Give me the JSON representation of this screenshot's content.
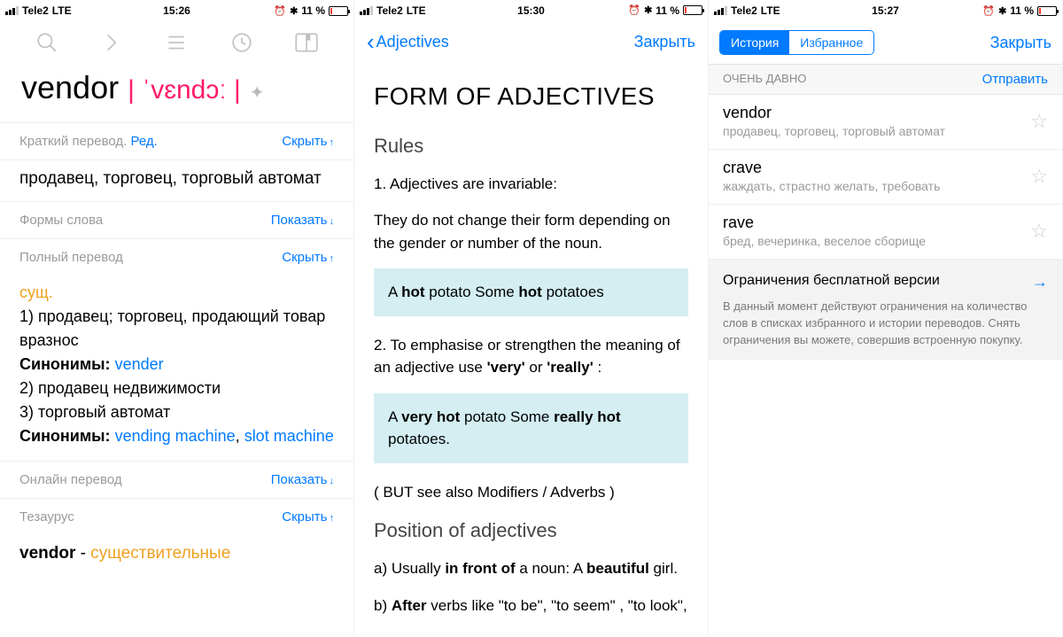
{
  "status": {
    "carrier": "Tele2",
    "network": "LTE",
    "battery_pct": "11 %",
    "alarm_icon": "⏰",
    "bt_icon": "✱"
  },
  "screen1": {
    "time": "15:26",
    "headword": "vendor",
    "phonetic": "| ˈvɛndɔː |",
    "brief_label": "Краткий перевод.",
    "edit": "Ред.",
    "hide": "Скрыть",
    "show": "Показать",
    "brief_translation": "продавец, торговец, торговый автомат",
    "forms_label": "Формы слова",
    "full_label": "Полный перевод",
    "pos": "сущ.",
    "line1": "1) продавец; торговец, продающий товар вразнос",
    "syn_label": "Синонимы:",
    "syn1": "vender",
    "line2": "2) продавец недвижимости",
    "line3": "3) торговый автомат",
    "syn2a": "vending machine",
    "syn2b": "slot machine",
    "online_label": "Онлайн перевод",
    "thesaurus_label": "Тезаурус",
    "thesaurus_word": "vendor",
    "thesaurus_pos": "существительные"
  },
  "screen2": {
    "time": "15:30",
    "back": "Adjectives",
    "close": "Закрыть",
    "title": "FORM OF ADJECTIVES",
    "rules": "Rules",
    "p1": "1. Adjectives are invariable:",
    "p2": "They do not change their form depending on the gender or number of the noun.",
    "ex1_a": "A ",
    "ex1_b": "hot",
    "ex1_c": " potato Some ",
    "ex1_d": "hot",
    "ex1_e": " potatoes",
    "p3a": "2. To emphasise or strengthen the meaning of an adjective use ",
    "p3b": "'very'",
    "p3c": " or ",
    "p3d": "'really'",
    "p3e": " :",
    "ex2_a": "A ",
    "ex2_b": "very hot",
    "ex2_c": " potato Some ",
    "ex2_d": "really hot",
    "ex2_e": " potatoes.",
    "note": "( BUT see also Modifiers / Adverbs )",
    "h2b": "Position of adjectives",
    "pa_a": "a) Usually ",
    "pa_b": "in front of",
    "pa_c": " a noun: A ",
    "pa_d": "beautiful",
    "pa_e": " girl.",
    "pb_a": "b) ",
    "pb_b": "After",
    "pb_c": " verbs like \"to be\", \"to seem\" , \"to look\","
  },
  "screen3": {
    "time": "15:27",
    "tab_history": "История",
    "tab_fav": "Избранное",
    "close": "Закрыть",
    "section": "ОЧЕНЬ ДАВНО",
    "send": "Отправить",
    "items": [
      {
        "title": "vendor",
        "sub": "продавец, торговец, торговый автомат"
      },
      {
        "title": "crave",
        "sub": "жаждать, страстно желать, требовать"
      },
      {
        "title": "rave",
        "sub": "бред, вечеринка, веселое сборище"
      }
    ],
    "limit_title": "Ограничения бесплатной версии",
    "limit_body": "В данный момент действуют ограничения на количество слов в списках избранного и истории переводов. Снять ограничения вы можете, совершив встроенную покупку."
  }
}
